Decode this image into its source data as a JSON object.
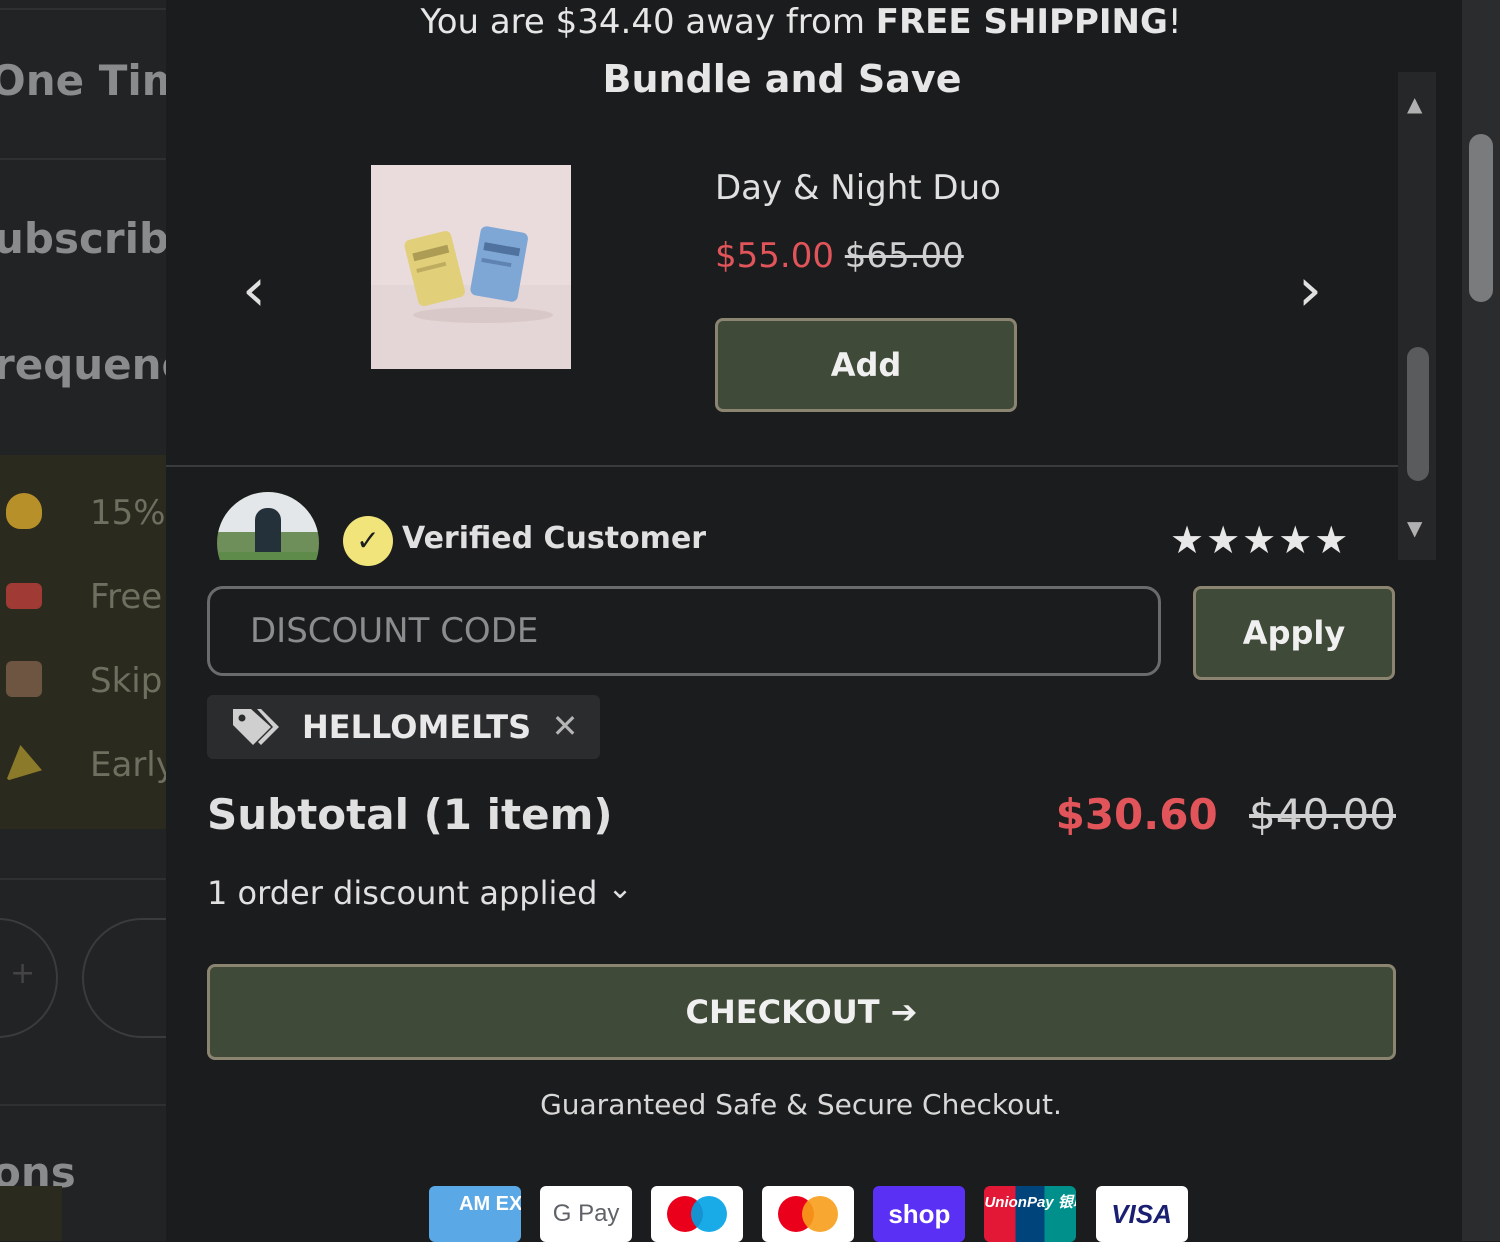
{
  "background": {
    "left_labels": [
      "One Time",
      "ubscribe",
      "requenc",
      "ons"
    ],
    "perks": [
      {
        "icon": "money-bag-icon",
        "label": "15%"
      },
      {
        "icon": "truck-icon",
        "label": "Free"
      },
      {
        "icon": "box-icon",
        "label": "Skip"
      },
      {
        "icon": "party-popper-icon",
        "label": "Early"
      }
    ],
    "stepper_minus": "+"
  },
  "shipping_banner": {
    "prefix": "You are $34.40 away from ",
    "emphasis": "FREE SHIPPING",
    "suffix": "!"
  },
  "upsell": {
    "title": "Bundle and Save",
    "product": {
      "name": "Day & Night Duo",
      "sale_price": "$55.00",
      "compare_price": "$65.00",
      "image_label_left": "DAYMELTS",
      "image_label_right": "DAY MELT"
    },
    "add_label": "Add",
    "prev_icon": "chevron-left-icon",
    "next_icon": "chevron-right-icon",
    "prev_glyph": "‹",
    "next_glyph": "›",
    "scroll_up_glyph": "▲",
    "scroll_down_glyph": "▼"
  },
  "review": {
    "badge_glyph": "✓",
    "verified_label": "Verified Customer",
    "stars": "★★★★★",
    "rating": 5
  },
  "discount": {
    "placeholder": "DISCOUNT CODE",
    "value": "",
    "apply_label": "Apply",
    "applied_code": "HELLOMELTS",
    "remove_glyph": "✕"
  },
  "summary": {
    "subtotal_label": "Subtotal (1 item)",
    "subtotal_sale": "$30.60",
    "subtotal_compare": "$40.00",
    "discount_note": "1 order discount applied",
    "discount_chevron": "⌄"
  },
  "checkout": {
    "label": "CHECKOUT ➔",
    "secure_note": "Guaranteed Safe & Secure Checkout."
  },
  "payment_methods": [
    {
      "name": "amex-icon",
      "text": "AM EX",
      "bg": "#5aa9e6",
      "fg": "#ffffff"
    },
    {
      "name": "google-pay-icon",
      "text": "G Pay",
      "bg": "#ffffff",
      "fg": "#5f6368"
    },
    {
      "name": "maestro-icon",
      "text": "",
      "bg": "#ffffff",
      "fg": "#000000"
    },
    {
      "name": "mastercard-icon",
      "text": "",
      "bg": "#ffffff",
      "fg": "#000000"
    },
    {
      "name": "shop-pay-icon",
      "text": "shop",
      "bg": "#5a31f4",
      "fg": "#ffffff"
    },
    {
      "name": "unionpay-icon",
      "text": "UnionPay 银联",
      "bg": "#e21836",
      "fg": "#ffffff"
    },
    {
      "name": "visa-icon",
      "text": "VISA",
      "bg": "#ffffff",
      "fg": "#1a1f71"
    }
  ],
  "colors": {
    "accent_green": "#3f4a38",
    "button_border": "#8a8470",
    "sale_red": "#e0545a",
    "drawer_bg": "#1b1c1d"
  }
}
